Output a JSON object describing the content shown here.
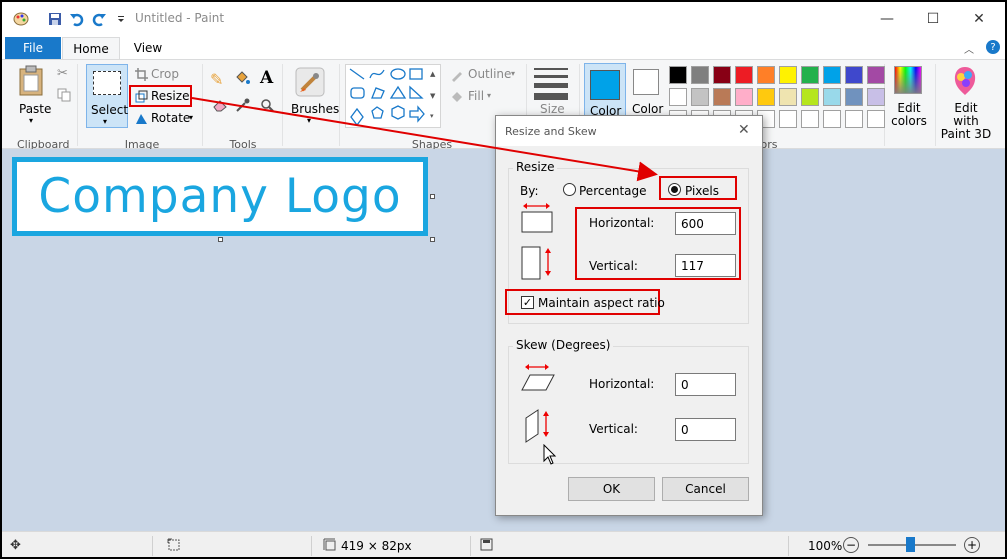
{
  "window": {
    "title": "Untitled - Paint",
    "minimize_glyph": "—",
    "maximize_glyph": "☐",
    "close_glyph": "✕"
  },
  "tabs": {
    "file": "File",
    "home": "Home",
    "view": "View"
  },
  "ribbon": {
    "paste": "Paste",
    "clipboard": "Clipboard",
    "select": "Select",
    "crop": "Crop",
    "resize": "Resize",
    "rotate": "Rotate",
    "image": "Image",
    "tools": "Tools",
    "brushes": "Brushes",
    "outline": "Outline",
    "fill": "Fill",
    "shapes": "Shapes",
    "size": "Size",
    "color1": "Color",
    "color2": "Color",
    "colors_partial": "ors",
    "edit_colors": "Edit colors",
    "edit_with_paint3d": "Edit with Paint 3D"
  },
  "palette": [
    "#000000",
    "#7f7f7f",
    "#880015",
    "#ed1c24",
    "#ff7f27",
    "#fff200",
    "#22b14c",
    "#00a2e8",
    "#3f48cc",
    "#a349a4",
    "#ffffff",
    "#c3c3c3",
    "#b97a57",
    "#ffaec9",
    "#ffc90e",
    "#efe4b0",
    "#b5e61d",
    "#99d9ea",
    "#7092be",
    "#c8bfe7"
  ],
  "colors": {
    "color1": "#00a2e8",
    "accent": "#1979ca",
    "highlight": "#e00000",
    "logo": "#1aa6e0"
  },
  "canvas": {
    "logo_text": "Company Logo"
  },
  "dialog": {
    "title": "Resize and Skew",
    "resize_legend": "Resize",
    "by_label": "By:",
    "percentage": "Percentage",
    "pixels": "Pixels",
    "horizontal_label": "Horizontal:",
    "horizontal_value": "600",
    "vertical_label": "Vertical:",
    "vertical_value": "117",
    "maintain_aspect": "Maintain aspect ratio",
    "skew_legend": "Skew (Degrees)",
    "skew_horizontal_label": "Horizontal:",
    "skew_horizontal_value": "0",
    "skew_vertical_label": "Vertical:",
    "skew_vertical_value": "0",
    "ok": "OK",
    "cancel": "Cancel"
  },
  "status": {
    "image_size": "419 × 82px",
    "zoom": "100%"
  }
}
